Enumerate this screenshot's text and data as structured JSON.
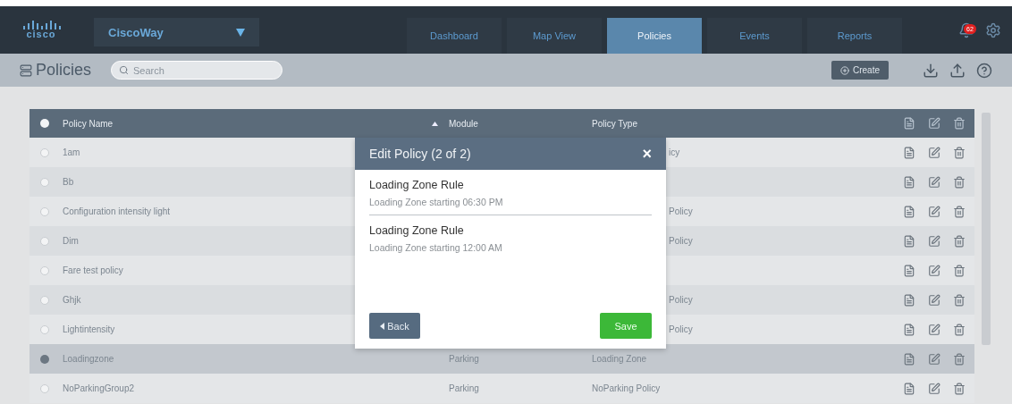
{
  "brand": {
    "logo_text": "cisco",
    "app_selector": "CiscoWay"
  },
  "tabs": [
    {
      "label": "Dashboard",
      "selected": false
    },
    {
      "label": "Map View",
      "selected": false
    },
    {
      "label": "Policies",
      "selected": true
    },
    {
      "label": "Events",
      "selected": false
    },
    {
      "label": "Reports",
      "selected": false
    }
  ],
  "notifications": {
    "count": "62"
  },
  "toolbar": {
    "title": "Policies",
    "search": {
      "placeholder": "Search"
    },
    "create_button": "Create"
  },
  "table": {
    "columns": [
      "Policy Name",
      "Module",
      "Policy Type"
    ],
    "header_selected": true,
    "rows": [
      {
        "name": "1am",
        "policy_type_tail": "icy",
        "selected": false
      },
      {
        "name": "Bb",
        "selected": false
      },
      {
        "name": "Configuration intensity light",
        "policy_type_tail": "Policy",
        "selected": false
      },
      {
        "name": "Dim",
        "policy_type_tail": "Policy",
        "selected": false
      },
      {
        "name": "Fare test policy",
        "selected": false
      },
      {
        "name": "Ghjk",
        "policy_type_tail": "Policy",
        "selected": false
      },
      {
        "name": "Lightintensity",
        "policy_type_tail": "Policy",
        "selected": false
      },
      {
        "name": "Loadingzone",
        "module": "Parking",
        "policy_type": "Loading Zone",
        "selected": true
      },
      {
        "name": "NoParkingGroup2",
        "module": "Parking",
        "policy_type": "NoParking Policy",
        "selected": false
      }
    ]
  },
  "dialog": {
    "title": "Edit Policy (2 of 2)",
    "close": "×",
    "rules": [
      {
        "title": "Loading Zone Rule",
        "detail": "Loading Zone starting 06:30 PM"
      },
      {
        "title": "Loading Zone Rule",
        "detail": "Loading Zone starting 12:00 AM"
      }
    ],
    "back_button": "Back",
    "save_button": "Save"
  }
}
